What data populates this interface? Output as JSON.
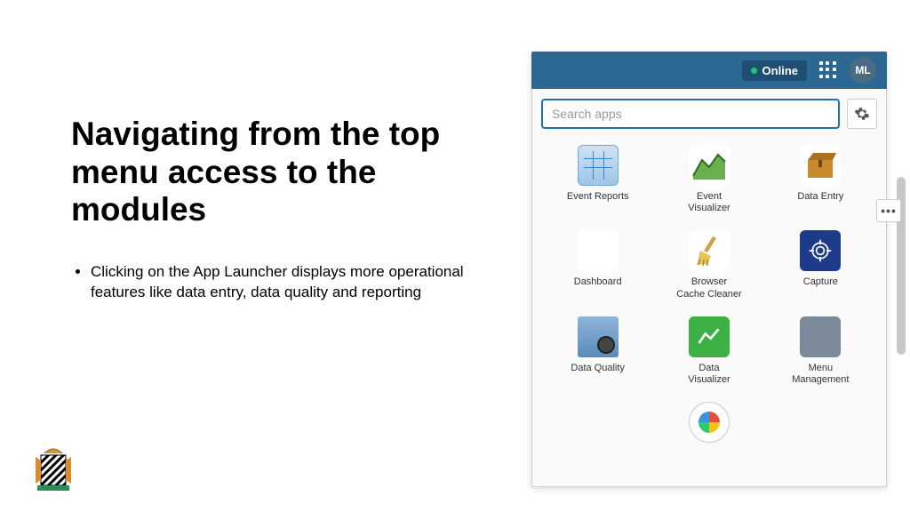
{
  "title": "Navigating from the top menu access to the modules",
  "bullet1": "Clicking on the App Launcher displays more operational features like data entry, data quality and reporting",
  "topbar": {
    "online": "Online",
    "avatar": "ML"
  },
  "search": {
    "placeholder": "Search apps"
  },
  "apps": {
    "a0": "Event Reports",
    "a1": "Event\nVisualizer",
    "a2": "Data Entry",
    "a3": "Dashboard",
    "a4": "Browser\nCache Cleaner",
    "a5": "Capture",
    "a6": "Data Quality",
    "a7": "Data\nVisualizer",
    "a8": "Menu\nManagement"
  },
  "ellipsis": "•••"
}
